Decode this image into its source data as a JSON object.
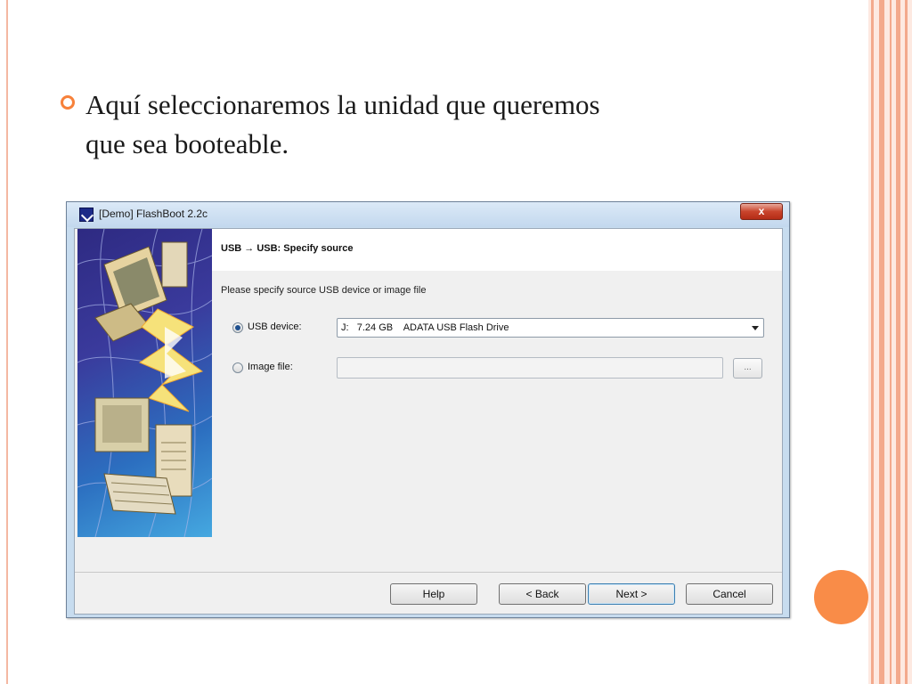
{
  "slide": {
    "bullet_text": "Aquí seleccionaremos la unidad que queremos que sea booteable."
  },
  "window": {
    "title": "[Demo] FlashBoot 2.2c",
    "close_label": "x"
  },
  "wizard": {
    "header_title": "USB → USB: Specify source",
    "instruction": "Please specify source USB device or image file",
    "usb_device_label": "USB device:",
    "usb_device_value": "J:   7.24 GB    ADATA USB Flash Drive",
    "image_file_label": "Image file:",
    "image_file_value": "",
    "browse_label": "...",
    "selected_source": "usb_device"
  },
  "buttons": {
    "help": "Help",
    "back": "< Back",
    "next": "Next >",
    "cancel": "Cancel"
  },
  "colors": {
    "accent": "#f7813a",
    "frame_line": "#f3a98c",
    "frame_band": "#fde9e1",
    "title_bar": "#c7dcef",
    "close_button": "#c9442c"
  }
}
